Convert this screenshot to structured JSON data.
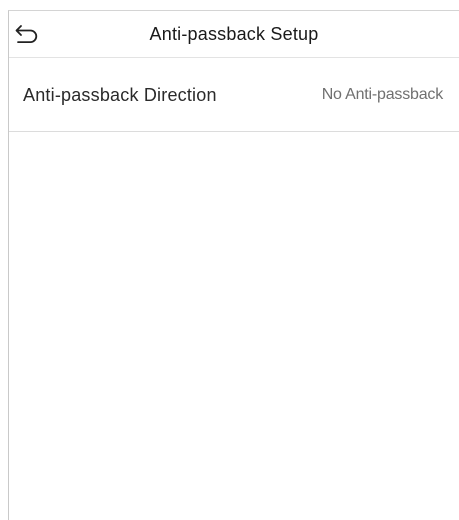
{
  "header": {
    "title": "Anti-passback Setup",
    "back_icon": "back-arrow-icon"
  },
  "settings": [
    {
      "label": "Anti-passback Direction",
      "value": "No Anti-passback"
    }
  ],
  "colors": {
    "text_primary": "#1a1a1a",
    "text_secondary": "#707070",
    "divider": "#dcdcdc",
    "background": "#ffffff"
  }
}
